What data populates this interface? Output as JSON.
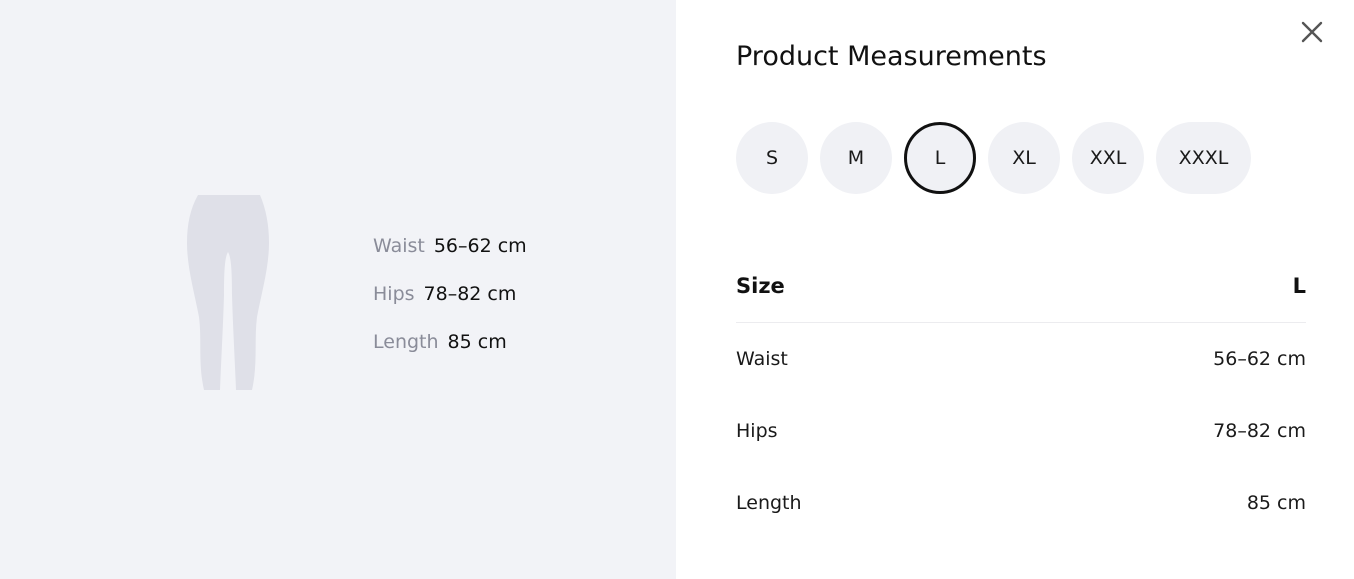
{
  "summary": {
    "rows": [
      {
        "label": "Waist",
        "value": "56–62 cm"
      },
      {
        "label": "Hips",
        "value": "78–82 cm"
      },
      {
        "label": "Length",
        "value": "85 cm"
      }
    ]
  },
  "panel": {
    "title": "Product Measurements",
    "close_icon": "close-icon",
    "sizes": [
      "S",
      "M",
      "L",
      "XL",
      "XXL",
      "XXXL"
    ],
    "selected_size": "L",
    "table": {
      "header_label": "Size",
      "header_value": "L",
      "rows": [
        {
          "label": "Waist",
          "value": "56–62 cm"
        },
        {
          "label": "Hips",
          "value": "78–82 cm"
        },
        {
          "label": "Length",
          "value": "85 cm"
        }
      ]
    }
  },
  "colors": {
    "left_background": "#f2f3f7",
    "figure_fill": "#dfe0e8",
    "chip_background": "#f0f1f5",
    "selected_border": "#111111",
    "muted_text": "#8a8c99"
  }
}
